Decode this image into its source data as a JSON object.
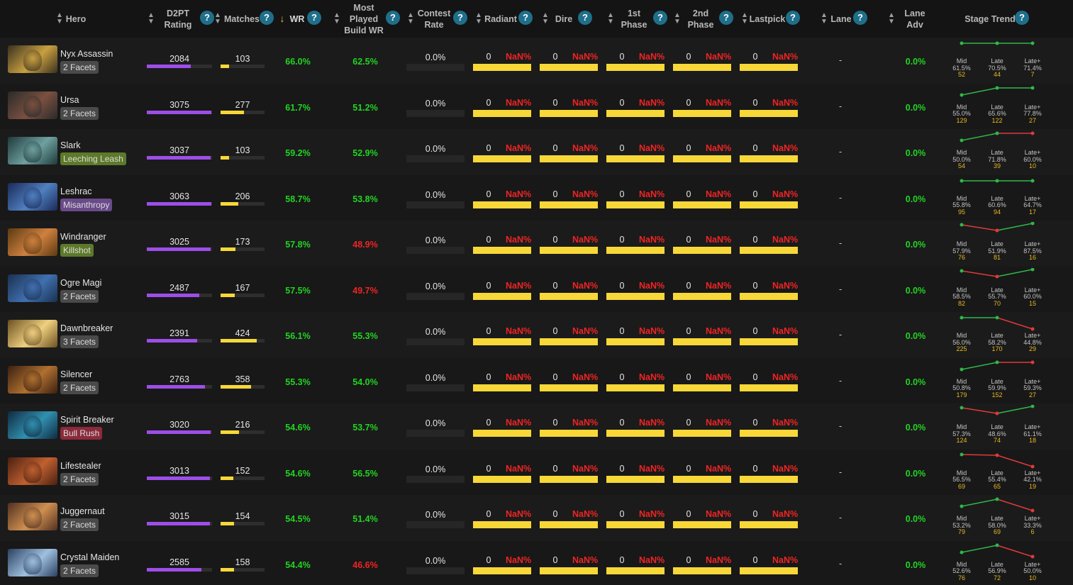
{
  "columns": [
    {
      "key": "hero",
      "label": "Hero",
      "help": false
    },
    {
      "key": "d2pt",
      "label": "D2PT Rating",
      "help": true
    },
    {
      "key": "matches",
      "label": "Matches",
      "help": true
    },
    {
      "key": "wr",
      "label": "WR",
      "help": true,
      "sorted": "desc"
    },
    {
      "key": "mpbwr",
      "label": "Most Played Build WR",
      "help": true
    },
    {
      "key": "contest",
      "label": "Contest Rate",
      "help": true
    },
    {
      "key": "radiant",
      "label": "Radiant",
      "help": true
    },
    {
      "key": "dire",
      "label": "Dire",
      "help": true
    },
    {
      "key": "phase1",
      "label": "1st Phase",
      "help": true
    },
    {
      "key": "phase2",
      "label": "2nd Phase",
      "help": true
    },
    {
      "key": "lastpick",
      "label": "Lastpick",
      "help": true
    },
    {
      "key": "lane",
      "label": "Lane",
      "help": true
    },
    {
      "key": "laneadv",
      "label": "Lane Adv",
      "help": false
    },
    {
      "key": "trend",
      "label": "Stage Trend",
      "help": true
    }
  ],
  "icons": {
    "sort": "sort-updown-icon",
    "sort_active": "sort-down-arrow-icon",
    "help": "help-circle-icon",
    "help_glyph": "?"
  },
  "colors": {
    "good": "#22d422",
    "bad": "#f02424",
    "rating_bar": "#9d4ee8",
    "matches_bar": "#f7d838",
    "help": "#1f6f8b",
    "facet_count": "#4a4a4a"
  },
  "stage_labels": [
    "Mid",
    "Late",
    "Late+"
  ],
  "rating_max": 3100,
  "matches_max": 430,
  "rows": [
    {
      "hero": "Nyx Assassin",
      "facet": "2 Facets",
      "facet_color": "#4a4a4a",
      "portrait_colors": [
        "#3a3020",
        "#c9a040"
      ],
      "rating": "2084",
      "matches": "103",
      "wr": "66.0%",
      "wr_good": true,
      "build_wr": "62.5%",
      "build_good": true,
      "contest": "0.0%",
      "radiant": [
        "0",
        "NaN%"
      ],
      "dire": [
        "0",
        "NaN%"
      ],
      "phase1": [
        "0",
        "NaN%"
      ],
      "phase2": [
        "0",
        "NaN%"
      ],
      "lastpick": [
        "0",
        "NaN%"
      ],
      "lane": "-",
      "lane_adv": "0.0%",
      "trend": {
        "wr": [
          "61.5%",
          "70.5%",
          "71.4%"
        ],
        "n": [
          "52",
          "44",
          "7"
        ],
        "dir": [
          "flat",
          "flat"
        ]
      }
    },
    {
      "hero": "Ursa",
      "facet": "2 Facets",
      "facet_color": "#4a4a4a",
      "portrait_colors": [
        "#2a2a2a",
        "#7a5040"
      ],
      "rating": "3075",
      "matches": "277",
      "wr": "61.7%",
      "wr_good": true,
      "build_wr": "51.2%",
      "build_good": true,
      "contest": "0.0%",
      "radiant": [
        "0",
        "NaN%"
      ],
      "dire": [
        "0",
        "NaN%"
      ],
      "phase1": [
        "0",
        "NaN%"
      ],
      "phase2": [
        "0",
        "NaN%"
      ],
      "lastpick": [
        "0",
        "NaN%"
      ],
      "lane": "-",
      "lane_adv": "0.0%",
      "trend": {
        "wr": [
          "55.0%",
          "65.6%",
          "77.8%"
        ],
        "n": [
          "129",
          "122",
          "27"
        ],
        "dir": [
          "up",
          "flat"
        ]
      }
    },
    {
      "hero": "Slark",
      "facet": "Leeching Leash",
      "facet_color": "#5c7a2a",
      "portrait_colors": [
        "#1e3a3a",
        "#70a0a0"
      ],
      "rating": "3037",
      "matches": "103",
      "wr": "59.2%",
      "wr_good": true,
      "build_wr": "52.9%",
      "build_good": true,
      "contest": "0.0%",
      "radiant": [
        "0",
        "NaN%"
      ],
      "dire": [
        "0",
        "NaN%"
      ],
      "phase1": [
        "0",
        "NaN%"
      ],
      "phase2": [
        "0",
        "NaN%"
      ],
      "lastpick": [
        "0",
        "NaN%"
      ],
      "lane": "-",
      "lane_adv": "0.0%",
      "trend": {
        "wr": [
          "50.0%",
          "71.8%",
          "60.0%"
        ],
        "n": [
          "54",
          "39",
          "10"
        ],
        "dir": [
          "up",
          "flat-red"
        ]
      }
    },
    {
      "hero": "Leshrac",
      "facet": "Misanthropy",
      "facet_color": "#6a4a8a",
      "portrait_colors": [
        "#1a2a5a",
        "#5080c0"
      ],
      "rating": "3063",
      "matches": "206",
      "wr": "58.7%",
      "wr_good": true,
      "build_wr": "53.8%",
      "build_good": true,
      "contest": "0.0%",
      "radiant": [
        "0",
        "NaN%"
      ],
      "dire": [
        "0",
        "NaN%"
      ],
      "phase1": [
        "0",
        "NaN%"
      ],
      "phase2": [
        "0",
        "NaN%"
      ],
      "lastpick": [
        "0",
        "NaN%"
      ],
      "lane": "-",
      "lane_adv": "0.0%",
      "trend": {
        "wr": [
          "55.8%",
          "60.6%",
          "64.7%"
        ],
        "n": [
          "95",
          "94",
          "17"
        ],
        "dir": [
          "flat",
          "flat"
        ]
      }
    },
    {
      "hero": "Windranger",
      "facet": "Killshot",
      "facet_color": "#5c7a2a",
      "portrait_colors": [
        "#5a3a10",
        "#d08040"
      ],
      "rating": "3025",
      "matches": "173",
      "wr": "57.8%",
      "wr_good": true,
      "build_wr": "48.9%",
      "build_good": false,
      "contest": "0.0%",
      "radiant": [
        "0",
        "NaN%"
      ],
      "dire": [
        "0",
        "NaN%"
      ],
      "phase1": [
        "0",
        "NaN%"
      ],
      "phase2": [
        "0",
        "NaN%"
      ],
      "lastpick": [
        "0",
        "NaN%"
      ],
      "lane": "-",
      "lane_adv": "0.0%",
      "trend": {
        "wr": [
          "57.9%",
          "51.9%",
          "87.5%"
        ],
        "n": [
          "76",
          "81",
          "16"
        ],
        "dir": [
          "down",
          "up"
        ]
      }
    },
    {
      "hero": "Ogre Magi",
      "facet": "2 Facets",
      "facet_color": "#4a4a4a",
      "portrait_colors": [
        "#1a3050",
        "#4070b0"
      ],
      "rating": "2487",
      "matches": "167",
      "wr": "57.5%",
      "wr_good": true,
      "build_wr": "49.7%",
      "build_good": false,
      "contest": "0.0%",
      "radiant": [
        "0",
        "NaN%"
      ],
      "dire": [
        "0",
        "NaN%"
      ],
      "phase1": [
        "0",
        "NaN%"
      ],
      "phase2": [
        "0",
        "NaN%"
      ],
      "lastpick": [
        "0",
        "NaN%"
      ],
      "lane": "-",
      "lane_adv": "0.0%",
      "trend": {
        "wr": [
          "58.5%",
          "55.7%",
          "60.0%"
        ],
        "n": [
          "82",
          "70",
          "15"
        ],
        "dir": [
          "down",
          "up"
        ]
      }
    },
    {
      "hero": "Dawnbreaker",
      "facet": "3 Facets",
      "facet_color": "#4a4a4a",
      "portrait_colors": [
        "#6a5020",
        "#f0d080"
      ],
      "rating": "2391",
      "matches": "424",
      "wr": "56.1%",
      "wr_good": true,
      "build_wr": "55.3%",
      "build_good": true,
      "contest": "0.0%",
      "radiant": [
        "0",
        "NaN%"
      ],
      "dire": [
        "0",
        "NaN%"
      ],
      "phase1": [
        "0",
        "NaN%"
      ],
      "phase2": [
        "0",
        "NaN%"
      ],
      "lastpick": [
        "0",
        "NaN%"
      ],
      "lane": "-",
      "lane_adv": "0.0%",
      "trend": {
        "wr": [
          "56.0%",
          "58.2%",
          "44.8%"
        ],
        "n": [
          "225",
          "170",
          "29"
        ],
        "dir": [
          "flat",
          "down"
        ]
      }
    },
    {
      "hero": "Silencer",
      "facet": "2 Facets",
      "facet_color": "#4a4a4a",
      "portrait_colors": [
        "#3a2010",
        "#b07030"
      ],
      "rating": "2763",
      "matches": "358",
      "wr": "55.3%",
      "wr_good": true,
      "build_wr": "54.0%",
      "build_good": true,
      "contest": "0.0%",
      "radiant": [
        "0",
        "NaN%"
      ],
      "dire": [
        "0",
        "NaN%"
      ],
      "phase1": [
        "0",
        "NaN%"
      ],
      "phase2": [
        "0",
        "NaN%"
      ],
      "lastpick": [
        "0",
        "NaN%"
      ],
      "lane": "-",
      "lane_adv": "0.0%",
      "trend": {
        "wr": [
          "50.8%",
          "59.9%",
          "59.3%"
        ],
        "n": [
          "179",
          "152",
          "27"
        ],
        "dir": [
          "up",
          "flat-red"
        ]
      }
    },
    {
      "hero": "Spirit Breaker",
      "facet": "Bull Rush",
      "facet_color": "#8a2a3a",
      "portrait_colors": [
        "#102a40",
        "#3090b0"
      ],
      "rating": "3020",
      "matches": "216",
      "wr": "54.6%",
      "wr_good": true,
      "build_wr": "53.7%",
      "build_good": true,
      "contest": "0.0%",
      "radiant": [
        "0",
        "NaN%"
      ],
      "dire": [
        "0",
        "NaN%"
      ],
      "phase1": [
        "0",
        "NaN%"
      ],
      "phase2": [
        "0",
        "NaN%"
      ],
      "lastpick": [
        "0",
        "NaN%"
      ],
      "lane": "-",
      "lane_adv": "0.0%",
      "trend": {
        "wr": [
          "57.3%",
          "48.6%",
          "61.1%"
        ],
        "n": [
          "124",
          "74",
          "18"
        ],
        "dir": [
          "down",
          "up"
        ]
      }
    },
    {
      "hero": "Lifestealer",
      "facet": "2 Facets",
      "facet_color": "#4a4a4a",
      "portrait_colors": [
        "#4a2010",
        "#c06030"
      ],
      "rating": "3013",
      "matches": "152",
      "wr": "54.6%",
      "wr_good": true,
      "build_wr": "56.5%",
      "build_good": true,
      "contest": "0.0%",
      "radiant": [
        "0",
        "NaN%"
      ],
      "dire": [
        "0",
        "NaN%"
      ],
      "phase1": [
        "0",
        "NaN%"
      ],
      "phase2": [
        "0",
        "NaN%"
      ],
      "lastpick": [
        "0",
        "NaN%"
      ],
      "lane": "-",
      "lane_adv": "0.0%",
      "trend": {
        "wr": [
          "56.5%",
          "55.4%",
          "42.1%"
        ],
        "n": [
          "69",
          "65",
          "19"
        ],
        "dir": [
          "flat-red",
          "down"
        ]
      }
    },
    {
      "hero": "Juggernaut",
      "facet": "2 Facets",
      "facet_color": "#4a4a4a",
      "portrait_colors": [
        "#503020",
        "#d09050"
      ],
      "rating": "3015",
      "matches": "154",
      "wr": "54.5%",
      "wr_good": true,
      "build_wr": "51.4%",
      "build_good": true,
      "contest": "0.0%",
      "radiant": [
        "0",
        "NaN%"
      ],
      "dire": [
        "0",
        "NaN%"
      ],
      "phase1": [
        "0",
        "NaN%"
      ],
      "phase2": [
        "0",
        "NaN%"
      ],
      "lastpick": [
        "0",
        "NaN%"
      ],
      "lane": "-",
      "lane_adv": "0.0%",
      "trend": {
        "wr": [
          "53.2%",
          "58.0%",
          "33.3%"
        ],
        "n": [
          "79",
          "69",
          "6"
        ],
        "dir": [
          "up",
          "down"
        ]
      }
    },
    {
      "hero": "Crystal Maiden",
      "facet": "2 Facets",
      "facet_color": "#4a4a4a",
      "portrait_colors": [
        "#2a4060",
        "#a0c0e0"
      ],
      "rating": "2585",
      "matches": "158",
      "wr": "54.4%",
      "wr_good": true,
      "build_wr": "46.6%",
      "build_good": false,
      "contest": "0.0%",
      "radiant": [
        "0",
        "NaN%"
      ],
      "dire": [
        "0",
        "NaN%"
      ],
      "phase1": [
        "0",
        "NaN%"
      ],
      "phase2": [
        "0",
        "NaN%"
      ],
      "lastpick": [
        "0",
        "NaN%"
      ],
      "lane": "-",
      "lane_adv": "0.0%",
      "trend": {
        "wr": [
          "52.6%",
          "56.9%",
          "50.0%"
        ],
        "n": [
          "76",
          "72",
          "10"
        ],
        "dir": [
          "up",
          "down"
        ]
      }
    }
  ]
}
